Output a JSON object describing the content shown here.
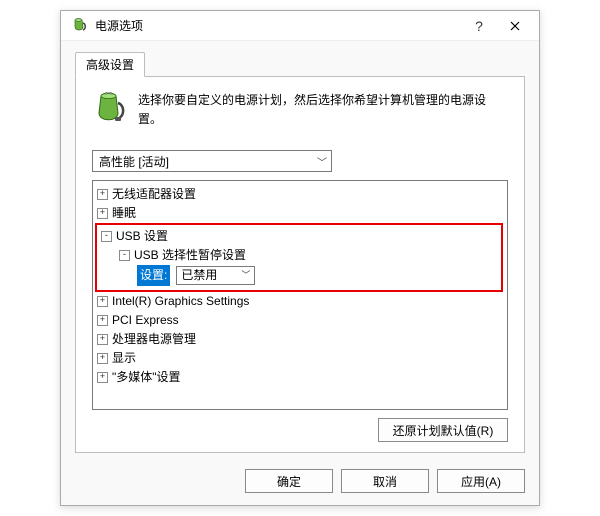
{
  "titlebar": {
    "title": "电源选项",
    "help": "?",
    "close": "✕"
  },
  "tab": {
    "label": "高级设置"
  },
  "intro": {
    "text": "选择你要自定义的电源计划，然后选择你希望计算机管理的电源设置。"
  },
  "plan": {
    "selected": "高性能 [活动]"
  },
  "tree": {
    "items": [
      {
        "label": "无线适配器设置"
      },
      {
        "label": "睡眠"
      },
      {
        "label": "USB 设置",
        "expanded": true,
        "children": [
          {
            "label": "USB 选择性暂停设置",
            "expanded": true,
            "setting": {
              "label": "设置:",
              "value": "已禁用"
            }
          }
        ]
      },
      {
        "label": "Intel(R) Graphics Settings"
      },
      {
        "label": "PCI Express"
      },
      {
        "label": "处理器电源管理"
      },
      {
        "label": "显示"
      },
      {
        "label": "\"多媒体\"设置"
      }
    ]
  },
  "buttons": {
    "restore": "还原计划默认值(R)",
    "ok": "确定",
    "cancel": "取消",
    "apply": "应用(A)"
  }
}
